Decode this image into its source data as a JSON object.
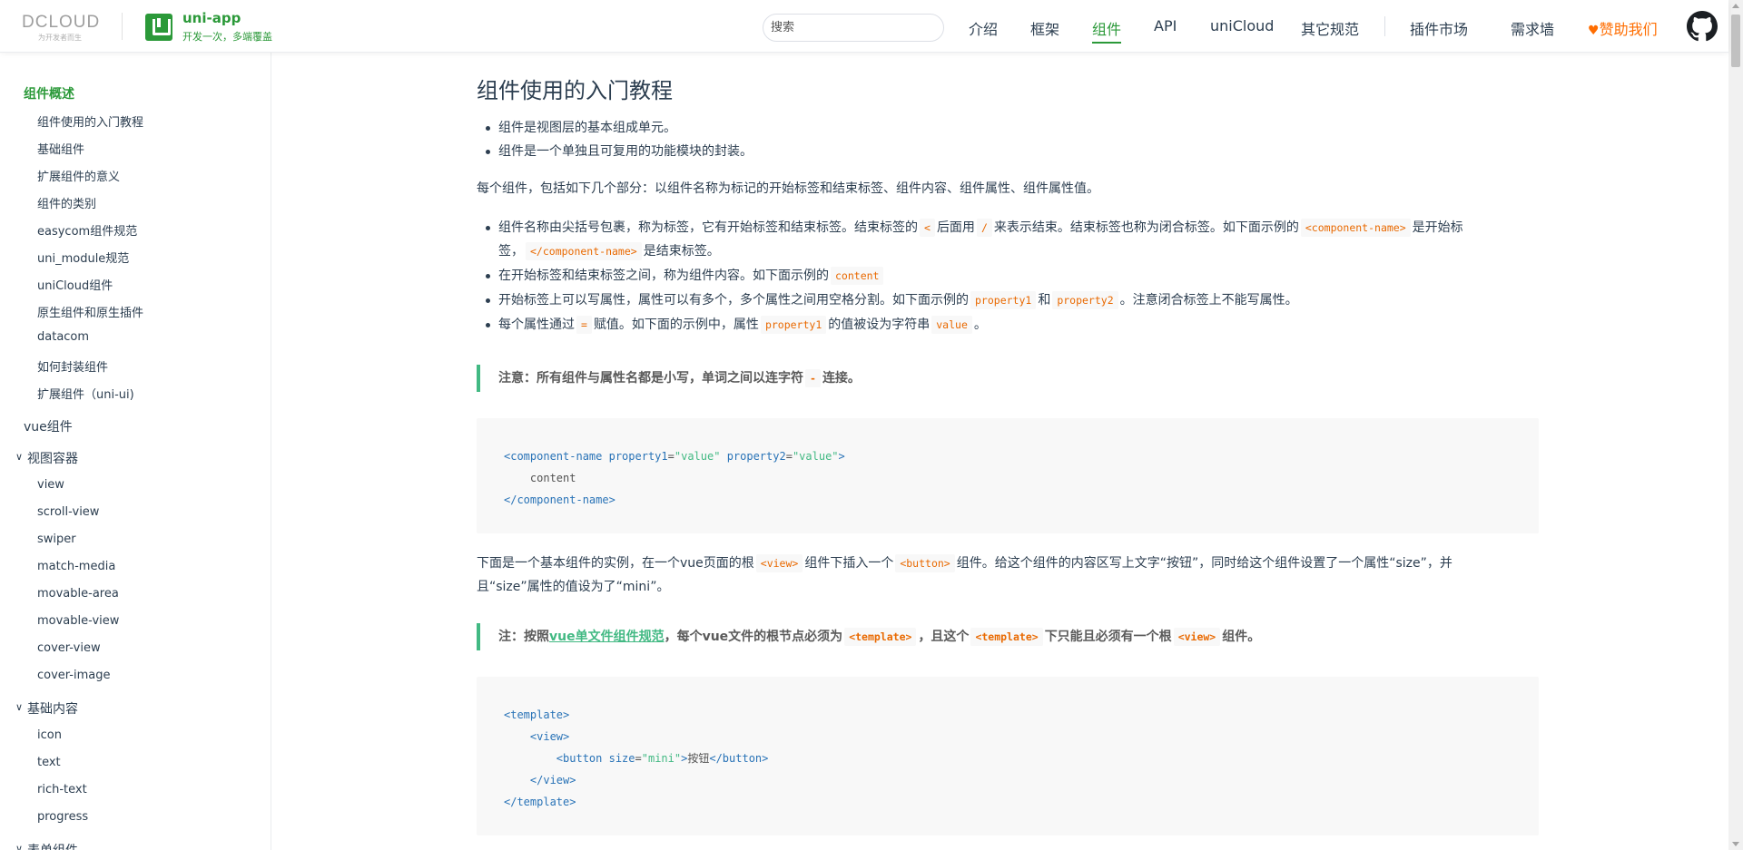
{
  "header": {
    "dcloud_word": "DCLOUD",
    "dcloud_sub": "为开发者而生",
    "brand_title": "uni-app",
    "brand_sub": "开发一次，多端覆盖",
    "search_placeholder": "搜索",
    "nav": [
      {
        "label": "介绍"
      },
      {
        "label": "框架"
      },
      {
        "label": "组件"
      },
      {
        "label": "API"
      },
      {
        "label": "uniCloud"
      },
      {
        "label": "其它规范"
      },
      {
        "label": "插件市场"
      },
      {
        "label": "需求墙"
      },
      {
        "label": "赞助我们"
      }
    ],
    "accent_color": "#2b9939",
    "sponsor_color": "#ff6d00"
  },
  "sidebar": {
    "groups": [
      {
        "label": "组件概述"
      },
      {
        "label": "vue组件"
      },
      {
        "label": "视图容器"
      },
      {
        "label": "基础内容"
      },
      {
        "label": "表单组件"
      }
    ],
    "overview_items": [
      "组件使用的入门教程",
      "基础组件",
      "扩展组件的意义",
      "组件的类别",
      "easycom组件规范",
      "uni_module规范",
      "uniCloud组件",
      "原生组件和原生插件",
      "datacom",
      "如何封装组件",
      "扩展组件（uni-ui)"
    ],
    "view_items": [
      "view",
      "scroll-view",
      "swiper",
      "match-media",
      "movable-area",
      "movable-view",
      "cover-view",
      "cover-image"
    ],
    "basic_items": [
      "icon",
      "text",
      "rich-text",
      "progress"
    ]
  },
  "content": {
    "title": "组件使用的入门教程",
    "bullets1": [
      "组件是视图层的基本组成单元。",
      "组件是一个单独且可复用的功能模块的封装。"
    ],
    "para1": "每个组件，包括如下几个部分：以组件名称为标记的开始标签和结束标签、组件内容、组件属性、组件属性值。",
    "b2_1a": "组件名称由尖括号包裹，称为标签，它有开始标签和结束标签。结束标签的",
    "b2_1_code1": "<",
    "b2_1b": "后面用",
    "b2_1_code2": "/",
    "b2_1c": "来表示结束。结束标签也称为闭合标签。如下面示例的",
    "b2_1_code3": "<component-name>",
    "b2_1d": "是开始标",
    "b2_1e": "签，",
    "b2_1_code4": "</component-name>",
    "b2_1f": "是结束标签。",
    "b2_2a": "在开始标签和结束标签之间，称为组件内容。如下面示例的",
    "b2_2_code": "content",
    "b2_3a": "开始标签上可以写属性，属性可以有多个，多个属性之间用空格分割。如下面示例的",
    "b2_3_code1": "property1",
    "b2_3b": "和",
    "b2_3_code2": "property2",
    "b2_3c": "。注意闭合标签上不能写属性。",
    "b2_4a": "每个属性通过",
    "b2_4_code1": "=",
    "b2_4b": "赋值。如下面的示例中，属性",
    "b2_4_code2": "property1",
    "b2_4c": "的值被设为字符串",
    "b2_4_code3": "value",
    "b2_4d": "。",
    "tip1a": "注意：所有组件与属性名都是小写，单词之间以连字符",
    "tip1_code": "-",
    "tip1b": "连接。",
    "code1": {
      "l1_open": "<component-name",
      "l1_attr1": "property1",
      "l1_eq1": "=",
      "l1_val1": "\"value\"",
      "l1_attr2": "property2",
      "l1_eq2": "=",
      "l1_val2": "\"value\"",
      "l1_close": ">",
      "l2": "content",
      "l3": "</component-name>"
    },
    "para2a": "下面是一个基本组件的实例，在一个vue页面的根",
    "para2_code1": "<view>",
    "para2b": "组件下插入一个",
    "para2_code2": "<button>",
    "para2c": "组件。给这个组件的内容区写上文字“按钮”，同时给这个组件设置了一个属性“size”，并",
    "para2d": "且“size”属性的值设为了“mini”。",
    "tip2a": "注：按照",
    "tip2_link": "vue单文件组件规范",
    "tip2b": "，每个vue文件的根节点必须为",
    "tip2_code1": "<template>",
    "tip2c": "，且这个",
    "tip2_code2": "<template>",
    "tip2d": "下只能且必须有一个根",
    "tip2_code3": "<view>",
    "tip2e": "组件。",
    "code2": {
      "l1": "<template>",
      "l2": "<view>",
      "l3_open": "<button",
      "l3_attr": "size",
      "l3_eq": "=",
      "l3_val": "\"mini\"",
      "l3_gt": ">",
      "l3_txt": "按钮",
      "l3_close": "</button>",
      "l4": "</view>",
      "l5": "</template>"
    }
  }
}
